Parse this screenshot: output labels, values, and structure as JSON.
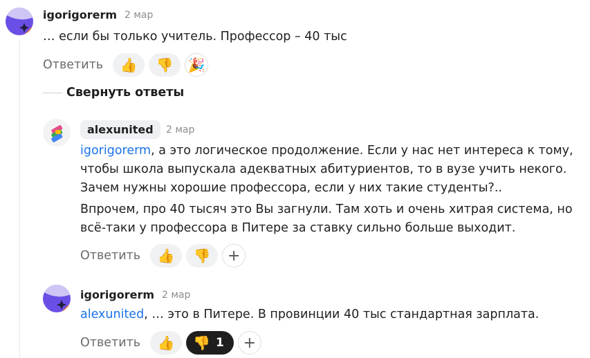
{
  "comments": [
    {
      "username": "igorigorerm",
      "date": "2 мар",
      "text": "… если бы только учитель. Профессор – 40 тыс",
      "reply_label": "Ответить",
      "reactions": [
        {
          "icon": "thumbs-up-icon",
          "glyph": "👍"
        },
        {
          "icon": "thumbs-down-icon",
          "glyph": "👎"
        },
        {
          "icon": "party-popper-icon",
          "glyph": "🎉"
        }
      ]
    },
    {
      "username": "alexunited",
      "date": "2 мар",
      "mention": "igorigorerm",
      "text_p1": ", а это логическое продолжение. Если у нас нет интереса к тому, чтобы школа выпускала адекватных абитуриентов, то в вузе учить некого. Зачем нужны хорошие профессора, если у них такие студенты?..",
      "text_p2": "Впрочем, про 40 тысяч это Вы загнули. Там хоть и очень хитрая система, но всё-таки у профессора в Питере за ставку сильно больше выходит.",
      "reply_label": "Ответить",
      "reactions": [
        {
          "icon": "thumbs-up-icon",
          "glyph": "👍"
        },
        {
          "icon": "thumbs-down-icon",
          "glyph": "👎"
        }
      ],
      "add_reaction": "+"
    },
    {
      "username": "igorigorerm",
      "date": "2 мар",
      "mention": "alexunited",
      "text": ", … это в Питере. В провинции 40 тыс стандартная зарплата.",
      "reply_label": "Ответить",
      "reactions": [
        {
          "icon": "thumbs-up-icon",
          "glyph": "👍"
        },
        {
          "icon": "thumbs-down-icon",
          "glyph": "👎",
          "count": "1",
          "active": true
        }
      ],
      "add_reaction": "+"
    }
  ],
  "collapse_label": "Свернуть ответы",
  "colors": {
    "mention": "#1a73e8",
    "avatar_purple": "#6b4ee6",
    "avatar_orange": "#f07a3a",
    "active_reaction": "#1e1e1e"
  }
}
